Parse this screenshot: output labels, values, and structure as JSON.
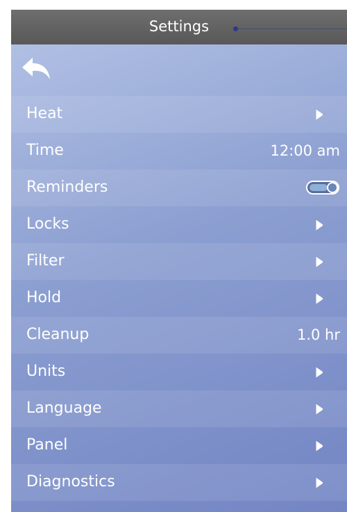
{
  "header": {
    "title": "Settings"
  },
  "icons": {
    "back": "back-arrow-icon",
    "row_arrow": "play-arrow-icon",
    "toggle": "toggle-switch-icon"
  },
  "colors": {
    "header_bg": "#5f5f5f",
    "screen_top": "#b5c4e6",
    "screen_bottom": "#7385c4",
    "callout": "#2b3a8a",
    "text": "#ffffff"
  },
  "menu": {
    "items": [
      {
        "label": "Heat"
      },
      {
        "label": "Time",
        "value": "12:00 am"
      },
      {
        "label": "Reminders",
        "toggle_state": "on"
      },
      {
        "label": "Locks"
      },
      {
        "label": "Filter"
      },
      {
        "label": "Hold"
      },
      {
        "label": "Cleanup",
        "value": "1.0 hr"
      },
      {
        "label": "Units"
      },
      {
        "label": "Language"
      },
      {
        "label": "Panel"
      },
      {
        "label": "Diagnostics"
      }
    ]
  }
}
